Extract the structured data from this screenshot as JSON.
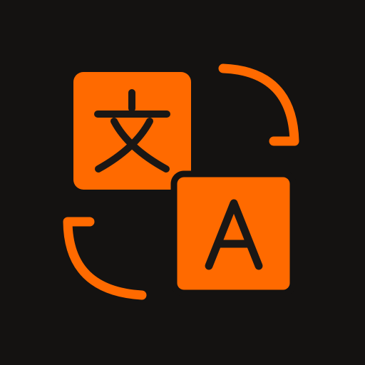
{
  "icon": {
    "name": "translate-icon",
    "glyph_source": "文",
    "glyph_target": "A"
  },
  "colors": {
    "background": "#141211",
    "accent": "#FF6A00",
    "glyph": "#1A1715"
  }
}
